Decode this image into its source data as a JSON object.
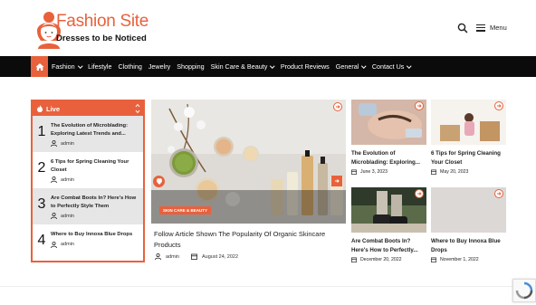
{
  "site": {
    "title": "Fashion Site",
    "tagline": "Dresses to be Noticed",
    "menu_label": "Menu",
    "accent": "#e8613c"
  },
  "nav": {
    "items": [
      {
        "label": "Fashion",
        "dropdown": true
      },
      {
        "label": "Lifestyle",
        "dropdown": false
      },
      {
        "label": "Clothing",
        "dropdown": false
      },
      {
        "label": "Jewelry",
        "dropdown": false
      },
      {
        "label": "Shopping",
        "dropdown": false
      },
      {
        "label": "Skin Care & Beauty",
        "dropdown": true
      },
      {
        "label": "Product Reviews",
        "dropdown": false
      },
      {
        "label": "General",
        "dropdown": true
      },
      {
        "label": "Contact Us",
        "dropdown": true
      }
    ]
  },
  "live": {
    "heading": "Live",
    "items": [
      {
        "num": "1",
        "title": "The Evolution of Microblading: Exploring Latest Trends and...",
        "author": "admin"
      },
      {
        "num": "2",
        "title": "6 Tips for Spring Cleaning Your Closet",
        "author": "admin"
      },
      {
        "num": "3",
        "title": "Are Combat Boots In? Here's How to Perfectly Style Them",
        "author": "admin"
      },
      {
        "num": "4",
        "title": "Where to Buy Innoxa Blue Drops",
        "author": "admin"
      }
    ]
  },
  "feature": {
    "badge": "SKIN CARE & BEAUTY",
    "title": "Follow Article Shown The Popularity Of Organic Skincare Products",
    "author": "admin",
    "date": "August 24, 2022"
  },
  "cards": [
    {
      "title": "The Evolution of Microblading: Exploring...",
      "date": "June 3, 2023"
    },
    {
      "title": "6 Tips for Spring Cleaning Your Closet",
      "date": "May 20, 2023"
    },
    {
      "title": "Are Combat Boots In? Here's How to Perfectly...",
      "date": "December 20, 2022"
    },
    {
      "title": "Where to Buy Innoxa Blue Drops",
      "date": "November 1, 2022"
    }
  ]
}
